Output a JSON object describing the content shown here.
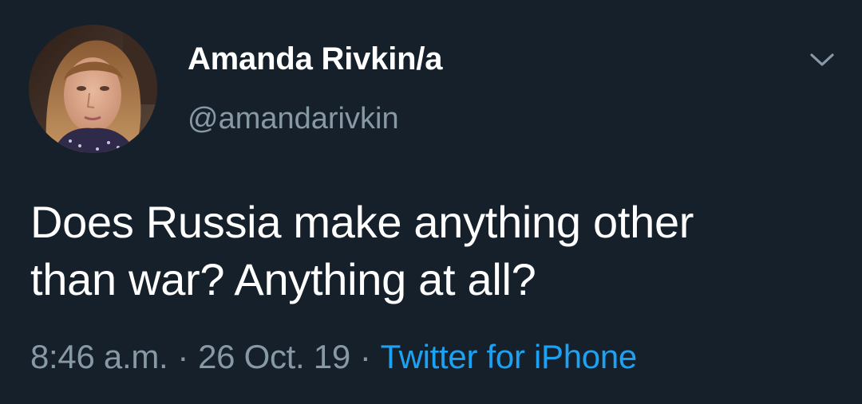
{
  "tweet": {
    "author": {
      "display_name": "Amanda Rivkin/a",
      "handle": "@amandarivkin"
    },
    "text_lines": [
      "Does Russia make anything other",
      "than war? Anything at all?"
    ],
    "time": "8:46 a.m.",
    "date": "26 Oct. 19",
    "separator": "·",
    "source": "Twitter for iPhone",
    "menu_icon": "chevron-down-icon"
  },
  "colors": {
    "background": "#15202b",
    "primary_text": "#ffffff",
    "secondary_text": "#8899a6",
    "link": "#1da1f2"
  }
}
